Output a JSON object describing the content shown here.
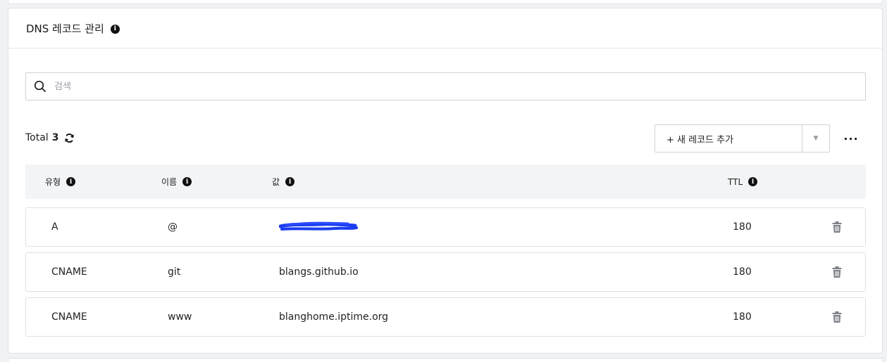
{
  "card": {
    "title": "DNS 레코드 관리"
  },
  "search": {
    "placeholder": "검색",
    "value": ""
  },
  "summary": {
    "total_label": "Total",
    "total_count": "3"
  },
  "toolbar": {
    "add_label": "+ 새 레코드 추가",
    "dropdown_glyph": "▼",
    "more_glyph": "···"
  },
  "table": {
    "columns": [
      "유형",
      "이름",
      "값",
      "TTL"
    ],
    "rows": [
      {
        "type": "A",
        "name": "@",
        "value": "",
        "ttl": "180",
        "value_redacted": true
      },
      {
        "type": "CNAME",
        "name": "git",
        "value": "blangs.github.io",
        "ttl": "180"
      },
      {
        "type": "CNAME",
        "name": "www",
        "value": "blanghome.iptime.org",
        "ttl": "180"
      }
    ]
  },
  "colors": {
    "redaction": "#1a3df0",
    "trash_icon": "#7d8187"
  }
}
